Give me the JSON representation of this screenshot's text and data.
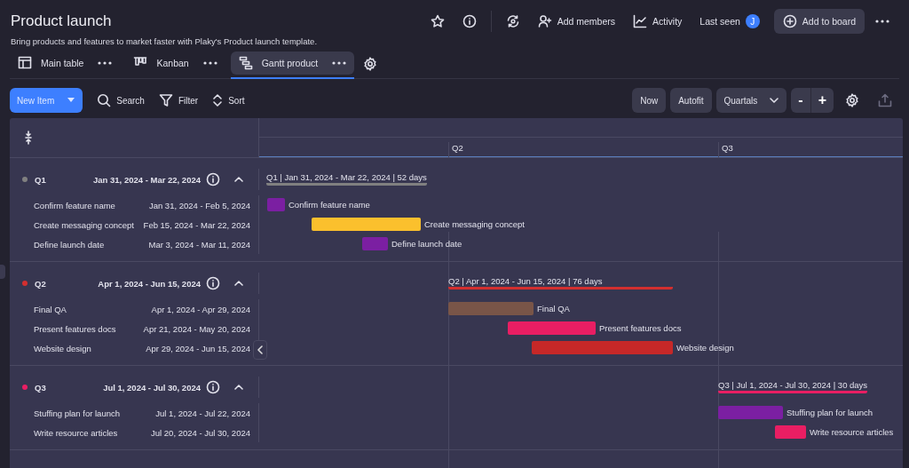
{
  "board": {
    "title": "Product launch",
    "description": "Bring products and features to market faster with Plaky's Product launch template."
  },
  "header": {
    "add_members": "Add members",
    "activity": "Activity",
    "last_seen": "Last seen",
    "avatar": "J",
    "add_to_board": "Add to board"
  },
  "tabs": [
    {
      "label": "Main table",
      "kind": "table",
      "selected": false
    },
    {
      "label": "Kanban",
      "kind": "kanban",
      "selected": false
    },
    {
      "label": "Gantt product",
      "kind": "gantt",
      "selected": true
    }
  ],
  "toolbar": {
    "new_item": "New Item",
    "search": "Search",
    "filter": "Filter",
    "sort": "Sort",
    "now": "Now",
    "autofit": "Autofit",
    "scale": "Quartals",
    "zoom_out": "-",
    "zoom_in": "+"
  },
  "timeline": {
    "columns": [
      "Q2",
      "Q3"
    ]
  },
  "groups": [
    {
      "name": "Q1",
      "dates": "Jan 31, 2024 - Mar 22, 2024",
      "color": "#808080",
      "expanded": true,
      "summary": "Q1 | Jan 31, 2024 - Mar 22, 2024 | 52 days",
      "items": [
        {
          "name": "Confirm feature name",
          "dates": "Jan 31, 2024 - Feb 5, 2024",
          "color": "#7b1fa2",
          "bar_label": "Confirm feature name"
        },
        {
          "name": "Create messaging concept",
          "dates": "Feb 15, 2024 - Mar 22, 2024",
          "color": "#fbc02d",
          "bar_label": "Create messaging concept"
        },
        {
          "name": "Define launch date",
          "dates": "Mar 3, 2024 - Mar 11, 2024",
          "color": "#7b1fa2",
          "bar_label": "Define launch date"
        }
      ]
    },
    {
      "name": "Q2",
      "dates": "Apr 1, 2024 - Jun 15, 2024",
      "color": "#d32f2f",
      "expanded": true,
      "summary": "Q2 | Apr 1, 2024 - Jun 15, 2024 | 76 days",
      "items": [
        {
          "name": "Final QA",
          "dates": "Apr 1, 2024 - Apr 29, 2024",
          "color": "#795548",
          "bar_label": "Final QA"
        },
        {
          "name": "Present features docs",
          "dates": "Apr 21, 2024 - May 20, 2024",
          "color": "#e91e63",
          "bar_label": "Present features docs"
        },
        {
          "name": "Website design",
          "dates": "Apr 29, 2024 - Jun 15, 2024",
          "color": "#c62828",
          "bar_label": "Website design"
        }
      ]
    },
    {
      "name": "Q3",
      "dates": "Jul 1, 2024 - Jul 30, 2024",
      "color": "#e91e63",
      "expanded": true,
      "summary": "Q3 | Jul 1, 2024 - Jul 30, 2024 | 30 days",
      "items": [
        {
          "name": "Stuffing plan for launch",
          "dates": "Jul 1, 2024 - Jul 22, 2024",
          "color": "#7b1fa2",
          "bar_label": "Stuffing plan for launch"
        },
        {
          "name": "Write resource articles",
          "dates": "Jul 20, 2024 - Jul 30, 2024",
          "color": "#e91e63",
          "bar_label": "Write resource articles"
        }
      ]
    }
  ]
}
